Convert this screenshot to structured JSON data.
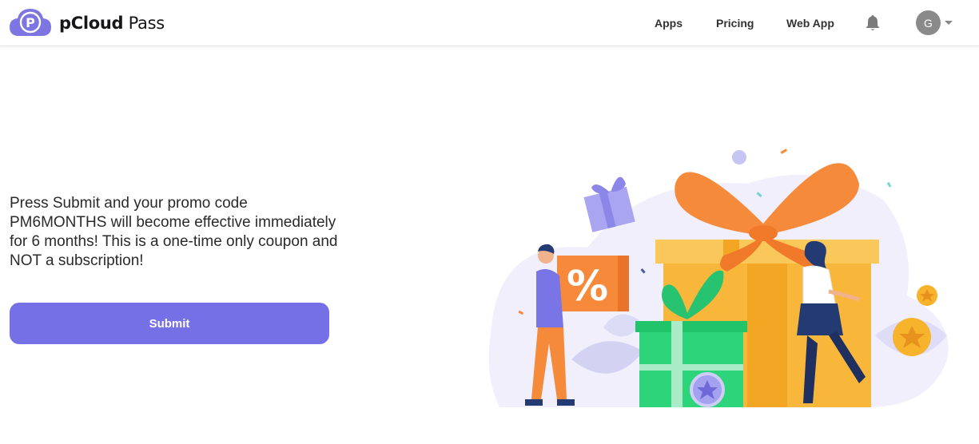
{
  "brand": {
    "name_bold": "pCloud",
    "name_light": " Pass"
  },
  "nav": {
    "apps": "Apps",
    "pricing": "Pricing",
    "web_app": "Web App"
  },
  "user": {
    "initial": "G"
  },
  "icons": {
    "logo": "pcloud-cloud-logo",
    "bell": "bell-icon",
    "caret": "chevron-down-icon"
  },
  "promo": {
    "message": "Press Submit and your promo code PM6MONTHS will become effective immediately for 6 months! This is a one-time only coupon and NOT a subscription!",
    "submit_label": "Submit",
    "gift_percent": "%"
  },
  "colors": {
    "accent": "#7570e5",
    "gift_orange": "#f6a21e",
    "gift_green": "#2ed47a"
  }
}
